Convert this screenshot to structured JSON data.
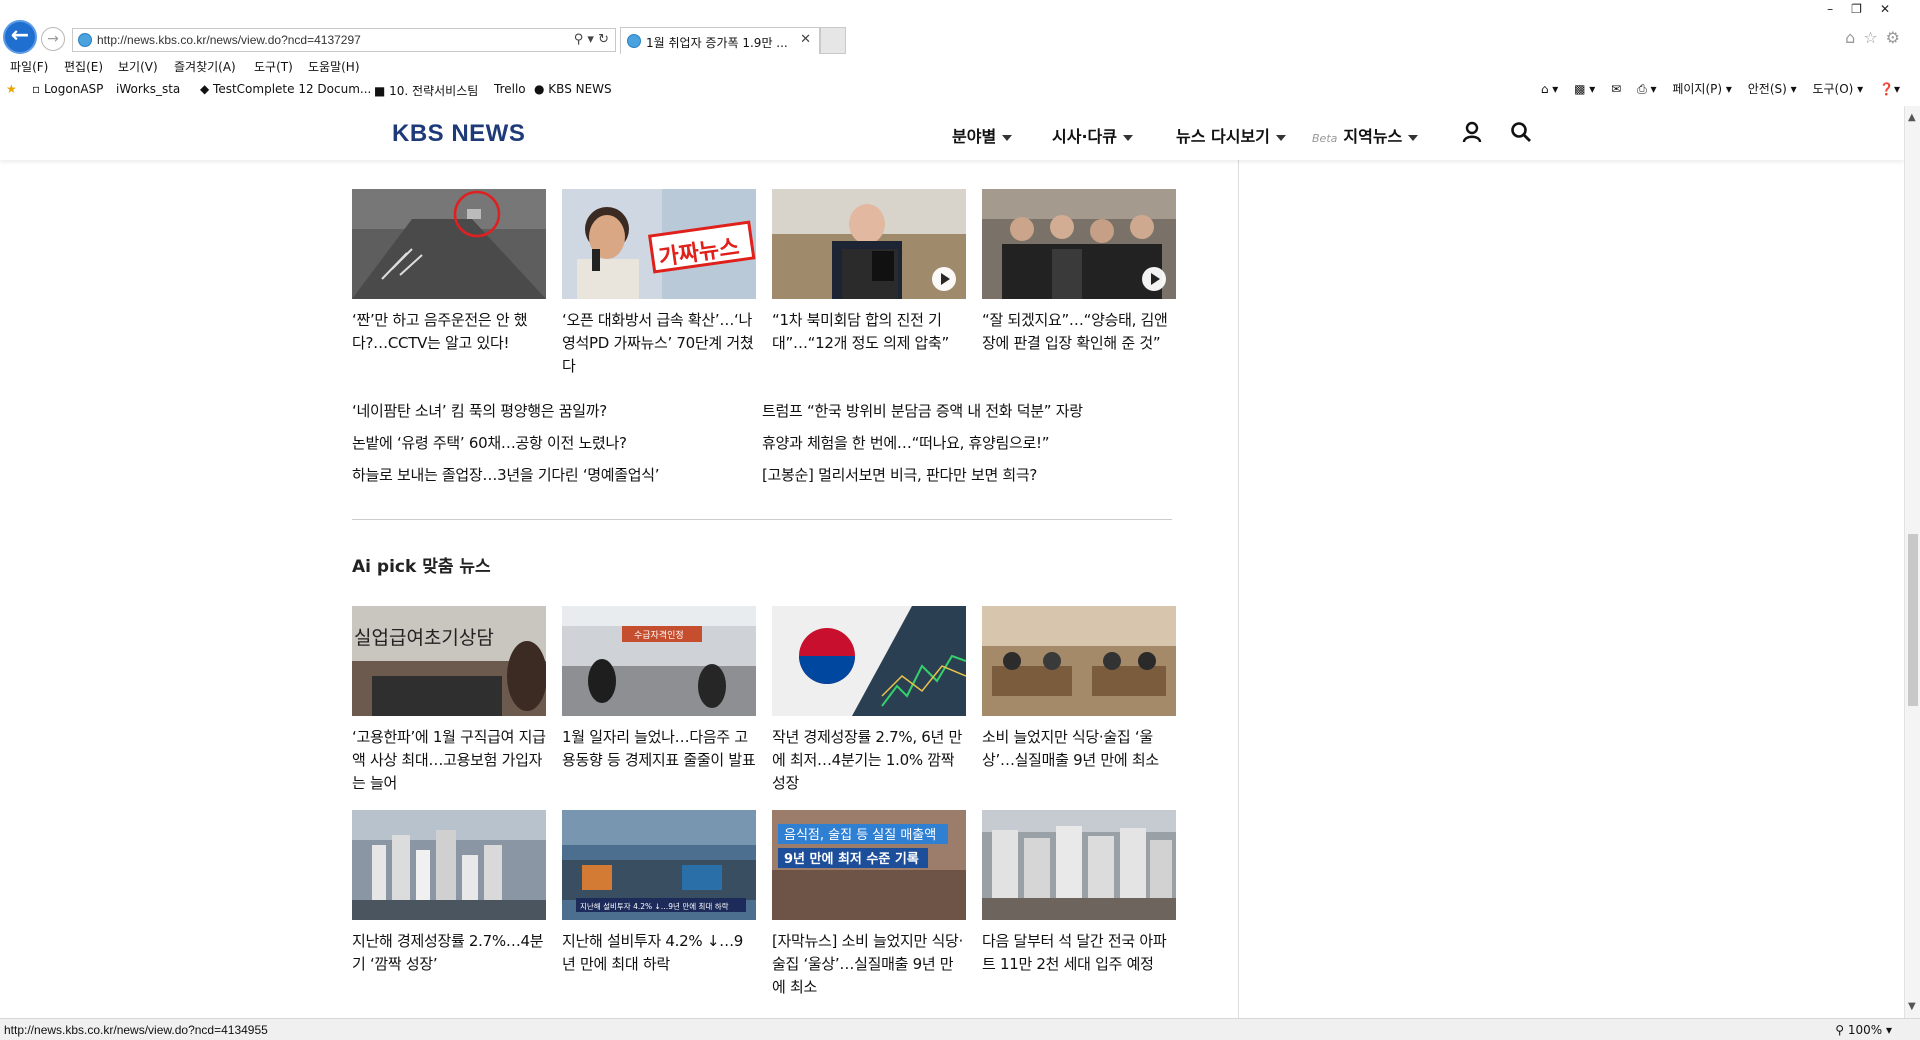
{
  "browser": {
    "url": "http://news.kbs.co.kr/news/view.do?ncd=4137297",
    "tab_title": "1월 취업자 증가폭 1.9만 ...",
    "menu": [
      "파일(F)",
      "편집(E)",
      "보기(V)",
      "즐겨찾기(A)",
      "도구(T)",
      "도움말(H)"
    ],
    "favorites": [
      "LogonASP",
      "iWorks_sta",
      "TestComplete 12 Docum...",
      "10. 전략서비스팀",
      "Trello",
      "KBS NEWS"
    ],
    "commands": [
      "페이지(P) ▾",
      "안전(S) ▾",
      "도구(O) ▾"
    ],
    "status_url": "http://news.kbs.co.kr/news/view.do?ncd=4134955",
    "zoom": "100%"
  },
  "site": {
    "logo": "KBS NEWS",
    "nav": [
      "분야별",
      "시사·다큐",
      "뉴스 다시보기",
      "지역뉴스"
    ],
    "nav_beta": "Beta"
  },
  "top_cards": [
    {
      "title": "‘짠’만 하고 음주운전은 안 했다?…CCTV는 알고 있다!",
      "video": false,
      "palette": "cctv"
    },
    {
      "title": "‘오픈 대화방서 급속 확산’…‘나영석PD 가짜뉴스’ 70단계 거쳤다",
      "video": false,
      "palette": "fake"
    },
    {
      "title": "“1차 북미회담 합의 진전 기대”…“12개 정도 의제 압축”",
      "video": true,
      "palette": "podium"
    },
    {
      "title": "“잘 되겠지요”…“양승태, 김앤장에 판결 입장 확인해 준 것”",
      "video": true,
      "palette": "crowd"
    }
  ],
  "text_links_left": [
    "‘네이팜탄 소녀’ 킴 푹의 평양행은 꿈일까?",
    "논밭에 ‘유령 주택’ 60채…공항 이전 노렸나?",
    "하늘로 보내는 졸업장…3년을 기다린 ‘명예졸업식’"
  ],
  "text_links_right": [
    "트럼프 “한국 방위비 분담금 증액 내 전화 덕분” 자랑",
    "휴양과 체험을 한 번에…“떠나요, 휴양림으로!”",
    "[고봉순] 멀리서보면 비극, 판다만 보면 희극?"
  ],
  "ai_pick": {
    "title": "Ai pick 맞춤 뉴스",
    "row1": [
      {
        "title": "‘고용한파’에 1월 구직급여 지급액 사상 최대…고용보험 가입자는 늘어",
        "overlay": "실업급여초기상담"
      },
      {
        "title": "1월 일자리 늘었나…다음주 고용동향 등 경제지표 줄줄이 발표",
        "overlay": "수급자격인정"
      },
      {
        "title": "작년 경제성장률 2.7%, 6년 만에 최저…4분기는 1.0% 깜짝성장",
        "overlay": ""
      },
      {
        "title": "소비 늘었지만 식당·술집 ‘울상’…실질매출 9년 만에 최소",
        "overlay": ""
      }
    ],
    "row2": [
      {
        "title": "지난해 경제성장률 2.7%…4분기 ‘깜짝 성장’",
        "overlay": ""
      },
      {
        "title": "지난해 설비투자 4.2% ↓…9년 만에 최대 하락",
        "overlay": "지난해 설비투자 4.2% ↓…9년 만에 최대 하락"
      },
      {
        "title": "[자막뉴스] 소비 늘었지만 식당·술집 ‘울상’…실질매출 9년 만에 최소",
        "overlay": "음식점, 술집 등 실질 매출액|9년 만에 최저 수준 기록"
      },
      {
        "title": "다음 달부터 석 달간 전국 아파트 11만 2천 세대 입주 예정",
        "overlay": ""
      }
    ]
  },
  "thumb_overlays": {
    "fake_news_stamp": "가짜뉴스"
  }
}
